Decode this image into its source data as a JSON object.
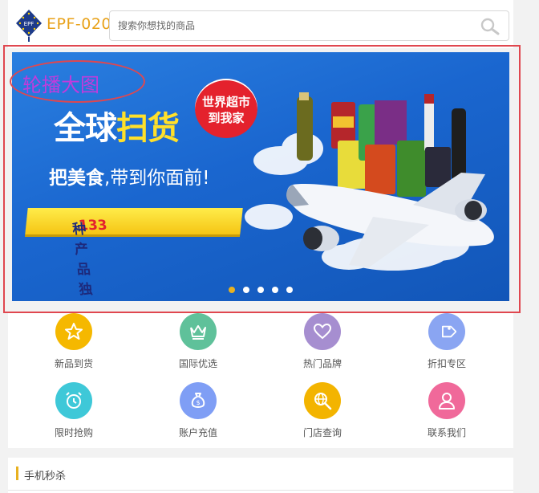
{
  "header": {
    "logo_text": "EPF-020",
    "logo_mark_text": "EPF",
    "search_placeholder": "搜索你想找的商品"
  },
  "banner": {
    "annotation": "轮播大图",
    "title_white": "全球",
    "title_yellow": "扫货",
    "badge_line1": "世界超市",
    "badge_line2": "到我家",
    "subtitle_bold": "把美食",
    "subtitle_rest": ",带到你面前!",
    "ribbon_number": "133",
    "ribbon_text": "种产品 独家代理",
    "active_slide": 1,
    "slide_count": 5
  },
  "menu": [
    {
      "label": "新品到货",
      "icon": "star-icon",
      "color": "#f5b800"
    },
    {
      "label": "国际优选",
      "icon": "crown-icon",
      "color": "#5fc19a"
    },
    {
      "label": "热门品牌",
      "icon": "heart-icon",
      "color": "#a68ed0"
    },
    {
      "label": "折扣专区",
      "icon": "tag-icon",
      "color": "#8aa5f2"
    },
    {
      "label": "限时抢购",
      "icon": "alarm-clock-icon",
      "color": "#3ec8d8"
    },
    {
      "label": "账户充值",
      "icon": "money-bag-icon",
      "color": "#7f9ef5"
    },
    {
      "label": "门店查询",
      "icon": "globe-search-icon",
      "color": "#f3b400"
    },
    {
      "label": "联系我们",
      "icon": "user-icon",
      "color": "#f0699a"
    }
  ],
  "flash_sale": {
    "title": "手机秒杀"
  },
  "colors": {
    "accent": "#e8b120",
    "annotation_frame": "#e0474f"
  }
}
